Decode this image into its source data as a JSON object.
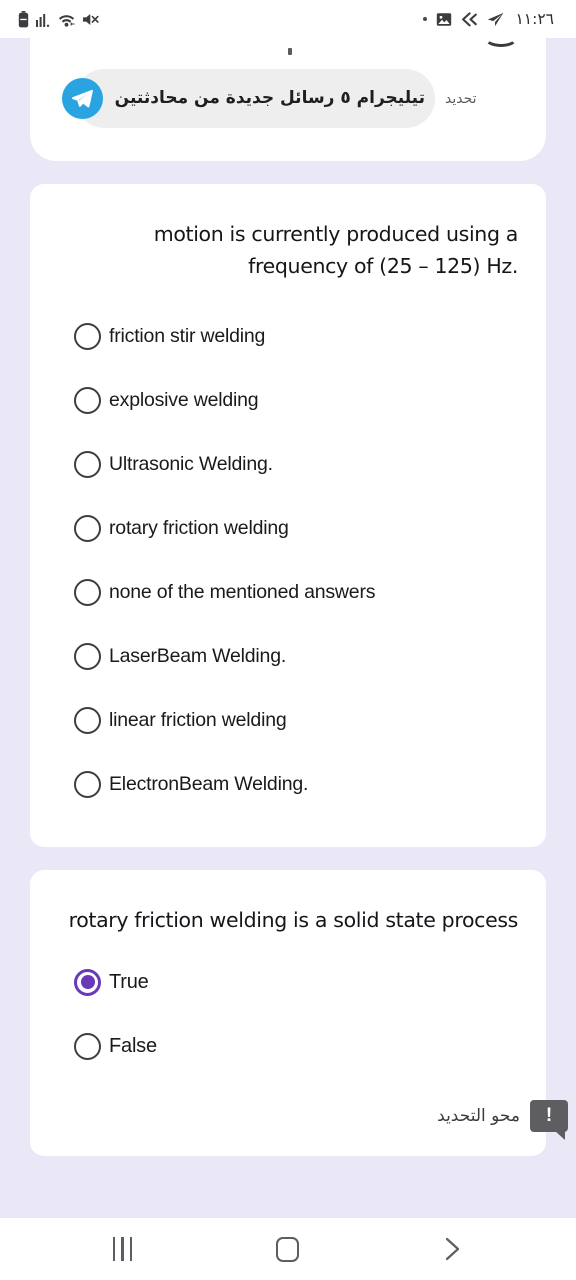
{
  "status_bar": {
    "time": "١١:٢٦",
    "left_icons": [
      "battery-icon",
      "signal-bars-icon",
      "wifi-icon",
      "mute-icon"
    ],
    "right_icons": [
      "dot-indicator-icon",
      "image-icon",
      "double-chevron-left-icon",
      "telegram-send-icon"
    ]
  },
  "notification": {
    "app_and_summary": "تيليجرام ٥ رسائل جديدة من محادثتين",
    "side_action": "تحديد",
    "icon": "telegram-icon"
  },
  "questions": [
    {
      "id": "q-welding-frequency",
      "text": "motion is currently produced using a frequency of (25 – 125) Hz.",
      "options": [
        {
          "label": "friction stir welding",
          "selected": false
        },
        {
          "label": "explosive welding",
          "selected": false
        },
        {
          "label": "Ultrasonic Welding.",
          "selected": false
        },
        {
          "label": "rotary friction welding",
          "selected": false
        },
        {
          "label": "none of the mentioned answers",
          "selected": false
        },
        {
          "label": "LaserBeam Welding.",
          "selected": false
        },
        {
          "label": "linear friction welding",
          "selected": false
        },
        {
          "label": "ElectronBeam Welding.",
          "selected": false
        }
      ]
    },
    {
      "id": "q-rotary-solid-state",
      "text": "rotary friction welding is a solid state process",
      "options": [
        {
          "label": "True",
          "selected": true
        },
        {
          "label": "False",
          "selected": false
        }
      ],
      "clear_selection_label": "محو التحديد"
    }
  ],
  "warning_badge": {
    "label": "!"
  },
  "nav_bar": {
    "recents": "recents-button",
    "home": "home-button",
    "back": "back-button"
  },
  "colors": {
    "page_background": "#eae7f6",
    "card_background": "#ffffff",
    "accent_purple": "#6a39b8",
    "telegram_blue": "#2aa4e0",
    "badge_gray": "#5d5d62"
  }
}
